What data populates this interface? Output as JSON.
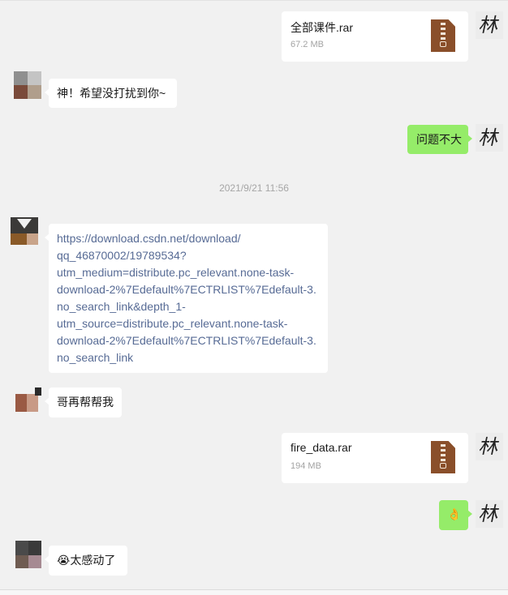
{
  "messages": {
    "file1": {
      "name": "全部课件.rar",
      "size": "67.2 MB",
      "icon": "zip-archive-icon"
    },
    "msg1": {
      "text": "神！希望没打扰到你~"
    },
    "msg2": {
      "text": "问题不大"
    },
    "timestamp": "2021/9/21 11:56",
    "link": {
      "lines": [
        "https://download.csdn.net/download/",
        "qq_46870002/19789534?",
        "utm_medium=distribute.pc_relevant.none-task-",
        "download-2%7Edefault%7ECTRLIST%7Edefault-3.",
        "no_search_link&depth_1-",
        "utm_source=distribute.pc_relevant.none-task-",
        "download-2%7Edefault%7ECTRLIST%7Edefault-3.",
        "no_search_link"
      ]
    },
    "msg3": {
      "text": "哥再帮帮我"
    },
    "file2": {
      "name": "fire_data.rar",
      "size": "194 MB",
      "icon": "zip-archive-icon"
    },
    "msg4": {
      "emoji": "👌",
      "icon": "ok-hand-emoji"
    },
    "msg5": {
      "emoji": "😭",
      "text": "太感动了",
      "icon": "tearful-face-emoji"
    }
  },
  "self_avatar": {
    "glyph": "林",
    "icon": "calligraphy-avatar"
  },
  "colors": {
    "background": "#f1f1f1",
    "incoming_bubble": "#ffffff",
    "outgoing_bubble": "#95ec69",
    "link": "#576b95",
    "archive": "#8a4f2a"
  }
}
